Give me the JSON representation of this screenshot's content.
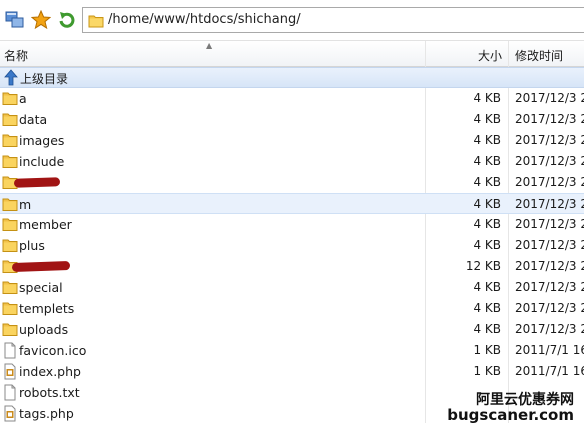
{
  "toolbar": {
    "address": "/home/www/htdocs/shichang/"
  },
  "columns": {
    "name": "名称",
    "size": "大小",
    "modified": "修改时间"
  },
  "parent_dir": {
    "label": "上级目录"
  },
  "files": [
    {
      "name": "a",
      "size": "4 KB",
      "modified": "2017/12/3 2",
      "type": "folder"
    },
    {
      "name": "data",
      "size": "4 KB",
      "modified": "2017/12/3 2",
      "type": "folder"
    },
    {
      "name": "images",
      "size": "4 KB",
      "modified": "2017/12/3 2",
      "type": "folder"
    },
    {
      "name": "include",
      "size": "4 KB",
      "modified": "2017/12/3 2",
      "type": "folder"
    },
    {
      "name": "",
      "size": "4 KB",
      "modified": "2017/12/3 2",
      "type": "folder",
      "redacted": true
    },
    {
      "name": "m",
      "size": "4 KB",
      "modified": "2017/12/3 2",
      "type": "folder",
      "selected": true
    },
    {
      "name": "member",
      "size": "4 KB",
      "modified": "2017/12/3 2",
      "type": "folder"
    },
    {
      "name": "plus",
      "size": "4 KB",
      "modified": "2017/12/3 2",
      "type": "folder"
    },
    {
      "name": "",
      "size": "12 KB",
      "modified": "2017/12/3 2",
      "type": "folder",
      "redacted": true
    },
    {
      "name": "special",
      "size": "4 KB",
      "modified": "2017/12/3 2",
      "type": "folder"
    },
    {
      "name": "templets",
      "size": "4 KB",
      "modified": "2017/12/3 2",
      "type": "folder"
    },
    {
      "name": "uploads",
      "size": "4 KB",
      "modified": "2017/12/3 2",
      "type": "folder"
    },
    {
      "name": "favicon.ico",
      "size": "1 KB",
      "modified": "2011/7/1 16",
      "type": "file"
    },
    {
      "name": "index.php",
      "size": "1 KB",
      "modified": "2011/7/1 16",
      "type": "php"
    },
    {
      "name": "robots.txt",
      "size": "",
      "modified": "",
      "type": "file"
    },
    {
      "name": "tags.php",
      "size": "",
      "modified": "",
      "type": "php"
    }
  ],
  "watermark": {
    "line1": "阿里云优惠券网",
    "line2": "bugscaner.com"
  }
}
